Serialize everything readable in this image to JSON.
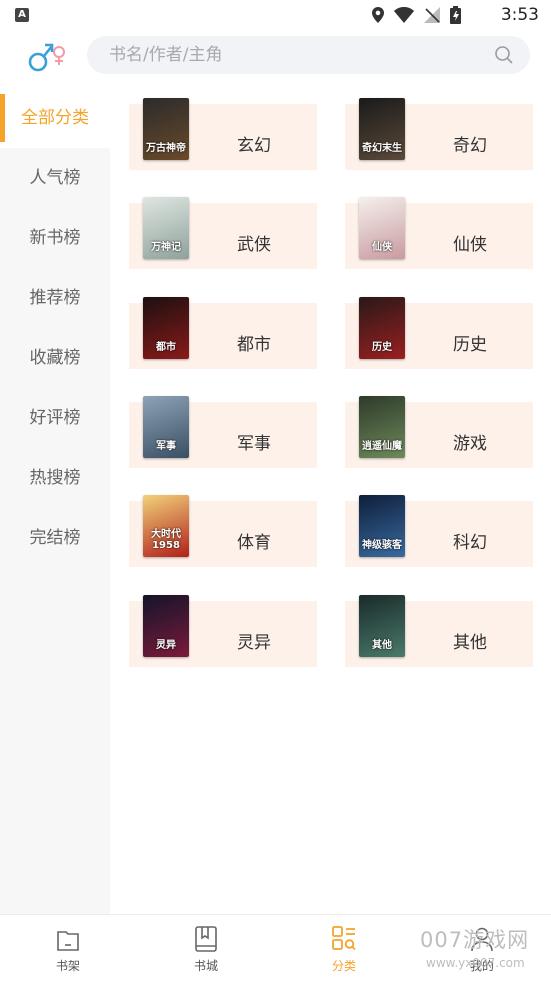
{
  "status_bar": {
    "time": "3:53",
    "notification_letter": "A"
  },
  "search": {
    "placeholder": "书名/作者/主角"
  },
  "sidebar": {
    "items": [
      {
        "label": "全部分类",
        "active": true
      },
      {
        "label": "人气榜"
      },
      {
        "label": "新书榜"
      },
      {
        "label": "推荐榜"
      },
      {
        "label": "收藏榜"
      },
      {
        "label": "好评榜"
      },
      {
        "label": "热搜榜"
      },
      {
        "label": "完结榜"
      }
    ]
  },
  "categories": [
    {
      "label": "玄幻",
      "cover_text": "万古神帝",
      "cover_colors": [
        "#2b2b2b",
        "#6a4a2a"
      ]
    },
    {
      "label": "奇幻",
      "cover_text": "奇幻末生",
      "cover_colors": [
        "#1a1a1a",
        "#5a4a3a"
      ]
    },
    {
      "label": "武侠",
      "cover_text": "万神记",
      "cover_colors": [
        "#dfe6e2",
        "#8fa19a"
      ]
    },
    {
      "label": "仙侠",
      "cover_text": "仙侠",
      "cover_colors": [
        "#f5f0ec",
        "#c89aa0"
      ]
    },
    {
      "label": "都市",
      "cover_text": "都市",
      "cover_colors": [
        "#1d1010",
        "#8a1a1a"
      ]
    },
    {
      "label": "历史",
      "cover_text": "历史",
      "cover_colors": [
        "#2a1818",
        "#9a2020"
      ]
    },
    {
      "label": "军事",
      "cover_text": "军事",
      "cover_colors": [
        "#8ea3b8",
        "#3b4f63"
      ]
    },
    {
      "label": "游戏",
      "cover_text": "逍遥仙魔",
      "cover_colors": [
        "#2e3a2a",
        "#6e8a5a"
      ]
    },
    {
      "label": "体育",
      "cover_text": "大时代1958",
      "cover_colors": [
        "#f2d27a",
        "#b0201a"
      ]
    },
    {
      "label": "科幻",
      "cover_text": "神级骇客",
      "cover_colors": [
        "#0e1e3a",
        "#3a6aa0"
      ]
    },
    {
      "label": "灵异",
      "cover_text": "灵异",
      "cover_colors": [
        "#14142a",
        "#7a1a3a"
      ]
    },
    {
      "label": "其他",
      "cover_text": "其他",
      "cover_colors": [
        "#1a2a2a",
        "#4a7a6a"
      ]
    }
  ],
  "bottom_nav": [
    {
      "label": "书架",
      "icon": "bookshelf-icon"
    },
    {
      "label": "书城",
      "icon": "book-icon"
    },
    {
      "label": "分类",
      "icon": "category-icon",
      "active": true
    },
    {
      "label": "我的",
      "icon": "profile-icon"
    }
  ],
  "watermark": {
    "line1": "007游戏网",
    "line2": "www.yx007.com"
  },
  "colors": {
    "accent": "#f5a32a",
    "card_bg": "#fdf1ea",
    "sidebar_bg": "#f7f7f8",
    "search_bg": "#f2f3f7"
  }
}
